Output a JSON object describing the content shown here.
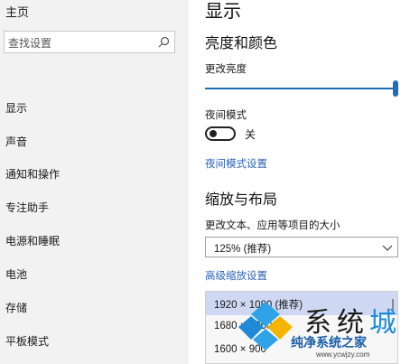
{
  "sidebar": {
    "home": "主页",
    "search_placeholder": "查找设置",
    "items": [
      {
        "label": "显示"
      },
      {
        "label": "声音"
      },
      {
        "label": "通知和操作"
      },
      {
        "label": "专注助手"
      },
      {
        "label": "电源和睡眠"
      },
      {
        "label": "电池"
      },
      {
        "label": "存储"
      },
      {
        "label": "平板模式"
      }
    ]
  },
  "main": {
    "title": "显示",
    "brightness_section": "亮度和颜色",
    "brightness_label": "更改亮度",
    "brightness_value": 100,
    "night_mode_label": "夜间模式",
    "night_mode_state": "关",
    "night_mode_link": "夜间模式设置",
    "layout_section": "缩放与布局",
    "scale_label": "更改文本、应用等项目的大小",
    "scale_value": "125% (推荐)",
    "advanced_scale_link": "高级缩放设置",
    "resolution_options": [
      {
        "label": "1920 × 1080 (推荐)",
        "selected": true
      },
      {
        "label": "1680 × 1050",
        "selected": false
      },
      {
        "label": "1600 × 900",
        "selected": false
      }
    ]
  },
  "watermark": {
    "big_text_a": "系统",
    "big_text_b": "城",
    "sub_text": "纯净系统之家",
    "url": "www.ycwjzy.com"
  },
  "colors": {
    "accent": "#1e6fb8",
    "link": "#2b63b8",
    "sidebar_bg": "#f2f2f2",
    "selected_option": "#cfd8f2"
  }
}
